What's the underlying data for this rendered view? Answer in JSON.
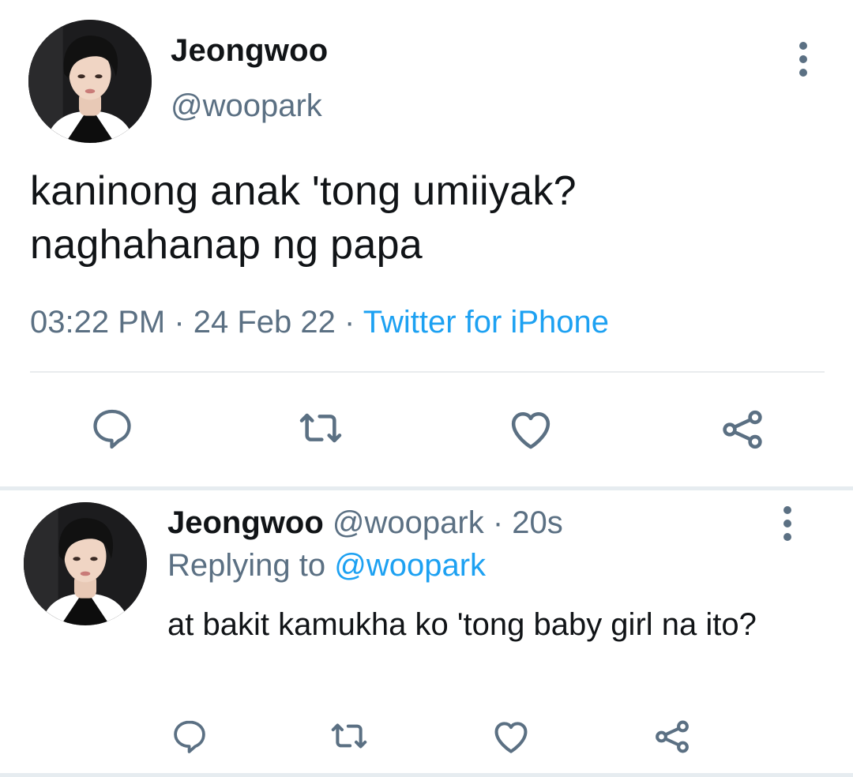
{
  "main_tweet": {
    "display_name": "Jeongwoo",
    "handle": "@woopark",
    "text_line1": "kaninong anak 'tong umiiyak?",
    "text_line2": "naghahanap ng papa",
    "time": "03:22 PM",
    "separator": " · ",
    "date": "24 Feb 22",
    "source": "Twitter for iPhone"
  },
  "reply_tweet": {
    "display_name": "Jeongwoo",
    "handle": "@woopark",
    "separator": " · ",
    "age": "20s",
    "replying_label": "Replying to ",
    "replying_to": "@woopark",
    "text": "at bakit kamukha ko 'tong baby girl na ito?"
  },
  "icons": {
    "more": "more-vertical-icon",
    "reply": "reply-bubble-icon",
    "retweet": "retweet-icon",
    "like": "heart-icon",
    "share": "share-icon"
  },
  "colors": {
    "text": "#111417",
    "secondary": "#5b7083",
    "accent": "#1da1f2",
    "divider": "#e6ecf0"
  }
}
